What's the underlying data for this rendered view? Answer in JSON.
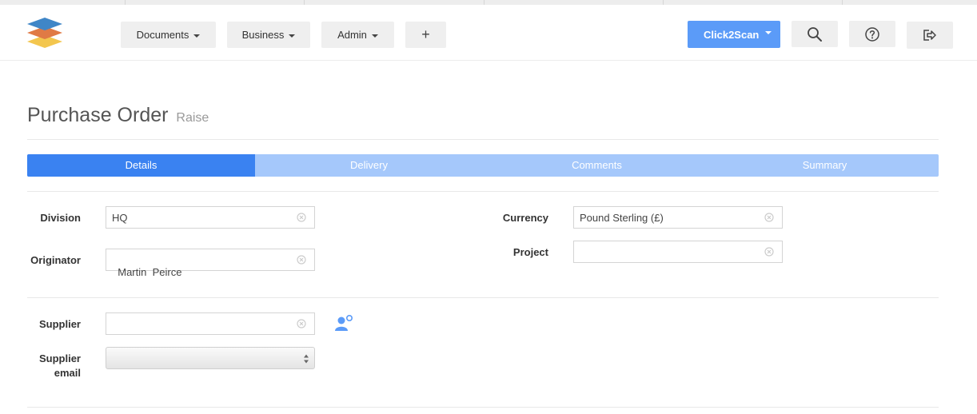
{
  "nav": {
    "menus": [
      {
        "label": "Documents"
      },
      {
        "label": "Business"
      },
      {
        "label": "Admin"
      }
    ],
    "add_label": "+",
    "scan_button": "Click2Scan"
  },
  "icons": {
    "logo": "stacked-layers-logo",
    "search": "search-icon",
    "help": "help-circle-icon",
    "logout": "logout-icon",
    "clear": "clear-circle-icon",
    "add_supplier": "add-person-icon",
    "select_arrows": "updown-arrows-icon"
  },
  "colors": {
    "primary": "#5b9bf8",
    "tab_active": "#3a82f1",
    "tab_inactive": "#a5c8fb",
    "logo_blue": "#3f86c7",
    "logo_orange": "#e07a45",
    "logo_yellow": "#f3c64e"
  },
  "page": {
    "title": "Purchase Order",
    "subtitle": "Raise"
  },
  "tabs": [
    {
      "label": "Details",
      "active": true
    },
    {
      "label": "Delivery",
      "active": false
    },
    {
      "label": "Comments",
      "active": false
    },
    {
      "label": "Summary",
      "active": false
    }
  ],
  "form": {
    "division": {
      "label": "Division",
      "value": "HQ"
    },
    "originator": {
      "label": "Originator",
      "value": "Martin  Peirce"
    },
    "currency": {
      "label": "Currency",
      "value": "Pound Sterling (£)"
    },
    "project": {
      "label": "Project",
      "value": ""
    },
    "supplier": {
      "label": "Supplier",
      "value": ""
    },
    "supplier_email": {
      "label_line1": "Supplier",
      "label_line2": "email",
      "value": ""
    }
  }
}
